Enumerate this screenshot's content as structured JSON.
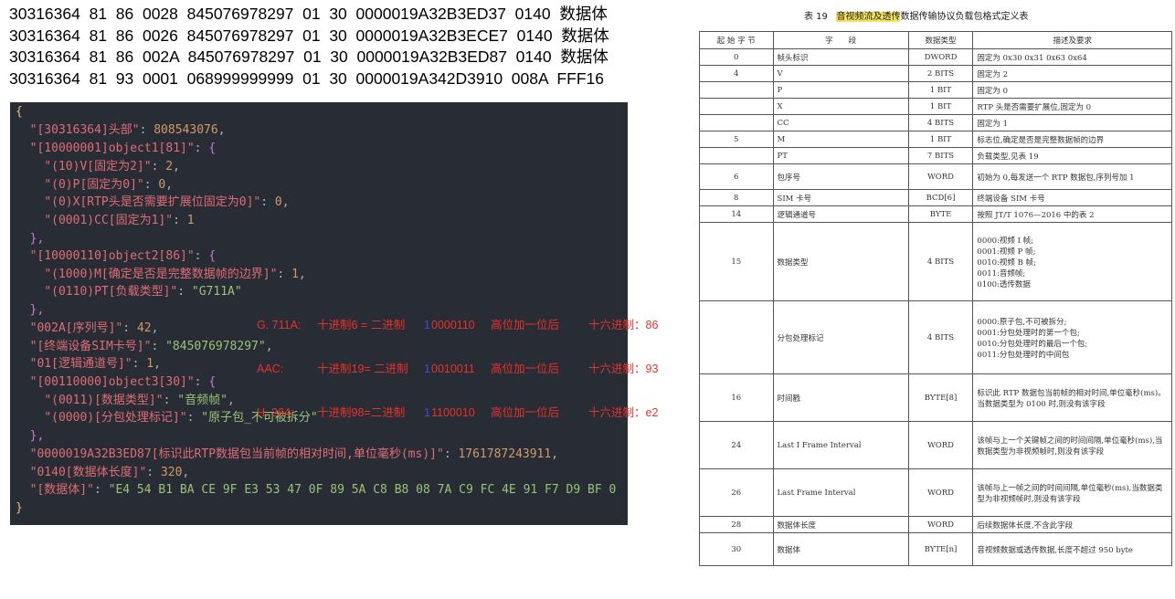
{
  "hex_lines": [
    "30316364  81  86  0028  845076978297  01  30  0000019A32B3ED37  0140  数据体",
    "30316364  81  86  0026  845076978297  01  30  0000019A32B3ECE7  0140  数据体",
    "30316364  81  86  002A  845076978297  01  30  0000019A32B3ED87  0140  数据体",
    "30316364  81  93  0001  068999999999  01  30  0000019A342D3910  008A  FFF16"
  ],
  "json_panel": {
    "open_brace": "{",
    "close_brace": "}",
    "header_key": "\"[30316364]头部\"",
    "header_val": "808543076",
    "obj1_key": "\"[10000001]object1[81]\"",
    "v_key": "\"(10)V[固定为2]\"",
    "v_val": "2",
    "p_key": "\"(0)P[固定为0]\"",
    "p_val": "0",
    "x_key": "\"(0)X[RTP头是否需要扩展位固定为0]\"",
    "x_val": "0",
    "cc_key": "\"(0001)CC[固定为1]\"",
    "cc_val": "1",
    "obj2_key": "\"[10000110]object2[86]\"",
    "m_key": "\"(1000)M[确定是否是完整数据帧的边界]\"",
    "m_val": "1",
    "pt_key": "\"(0110)PT[负载类型]\"",
    "pt_val": "\"G711A\"",
    "seq_key": "\"002A[序列号]\"",
    "seq_val": "42",
    "sim_key": "\"[终端设备SIM卡号]\"",
    "sim_val": "\"845076978297\"",
    "chan_key": "\"01[逻辑通道号]\"",
    "chan_val": "1",
    "obj3_key": "\"[00110000]object3[30]\"",
    "dtype_key": "\"(0011)[数据类型]\"",
    "dtype_val": "\"音频帧\"",
    "pkt_key": "\"(0000)[分包处理标记]\"",
    "pkt_val": "\"原子包_不可被拆分\"",
    "ts_key": "\"0000019A32B3ED87[标识此RTP数据包当前帧的相对时间,单位毫秒(ms)]\"",
    "ts_val": "1761787243911",
    "len_key": "\"0140[数据体长度]\"",
    "len_val": "320",
    "body_key": "\"[数据体]\"",
    "body_val": "\"E4 54 B1 BA CE 9F E3 53 47 0F 89 5A C8 B8 08 7A C9 FC 4E 91 F7 D9 BF 0"
  },
  "annotation": [
    {
      "name": "G. 711A:",
      "dec": "十进制6 = 二进制",
      "bit": "1",
      "bin": "0000110",
      "note": "高位加一位后",
      "hex": "十六进制：86"
    },
    {
      "name": "AAC:",
      "dec": "十进制19= 二进制",
      "bit": "1",
      "bin": "0010011",
      "note": "高位加一位后",
      "hex": "十六进制：93"
    },
    {
      "name": "H. 264:",
      "dec": "十进制98=二进制",
      "bit": "1",
      "bin": "1100010",
      "note": "高位加一位后",
      "hex": "十六进制：e2"
    }
  ],
  "table": {
    "title_prefix": "表 19",
    "title_highlight": "音视频流及透传",
    "title_suffix": "数据传输协议负载包格式定义表",
    "headers": [
      "起 始 字 节",
      "字　　段",
      "数据类型",
      "描述及要求"
    ],
    "rows": [
      [
        "0",
        "帧头标识",
        "DWORD",
        "固定为 0x30 0x31 0x63 0x64"
      ],
      [
        "4",
        "V",
        "2 BITS",
        "固定为 2"
      ],
      [
        "",
        "P",
        "1 BIT",
        "固定为 0"
      ],
      [
        "",
        "X",
        "1 BIT",
        "RTP 头是否需要扩展位,固定为 0"
      ],
      [
        "",
        "CC",
        "4 BITS",
        "固定为 1"
      ],
      [
        "5",
        "M",
        "1 BIT",
        "标志位,确定是否是完整数据帧的边界"
      ],
      [
        "",
        "PT",
        "7 BITS",
        "负载类型,见表 19"
      ],
      [
        "6",
        "包序号",
        "WORD",
        "初始为 0,每发送一个 RTP 数据包,序列号加 1"
      ],
      [
        "8",
        "SIM 卡号",
        "BCD[6]",
        "终端设备 SIM 卡号"
      ],
      [
        "14",
        "逻辑通道号",
        "BYTE",
        "按照 JT/T 1076—2016 中的表 2"
      ],
      [
        "15",
        "数据类型",
        "4 BITS",
        "0000:视频 I 帧;\n0001:视频 P 帧;\n0010:视频 B 帧;\n0011:音频帧;\n0100:透传数据"
      ],
      [
        "",
        "分包处理标记",
        "4 BITS",
        "0000:原子包,不可被拆分;\n0001:分包处理时的第一个包;\n0010:分包处理时的最后一个包;\n0011:分包处理时的中间包"
      ],
      [
        "16",
        "时间戳",
        "BYTE[8]",
        "标识此 RTP 数据包当前帧的相对时间,单位毫秒(ms)。当数据类型为 0100 时,则没有该字段"
      ],
      [
        "24",
        "Last I Frame Interval",
        "WORD",
        "该帧与上一个关键帧之间的时间间隔,单位毫秒(ms),当数据类型为非视频帧时,则没有该字段"
      ],
      [
        "26",
        "Last Frame Interval",
        "WORD",
        "该帧与上一帧之间的时间间隔,单位毫秒(ms),当数据类型为非视频帧时,则没有该字段"
      ],
      [
        "28",
        "数据体长度",
        "WORD",
        "后续数据体长度,不含此字段"
      ],
      [
        "30",
        "数据体",
        "BYTE[n]",
        "音视频数据或透传数据,长度不超过 950 byte"
      ]
    ]
  }
}
